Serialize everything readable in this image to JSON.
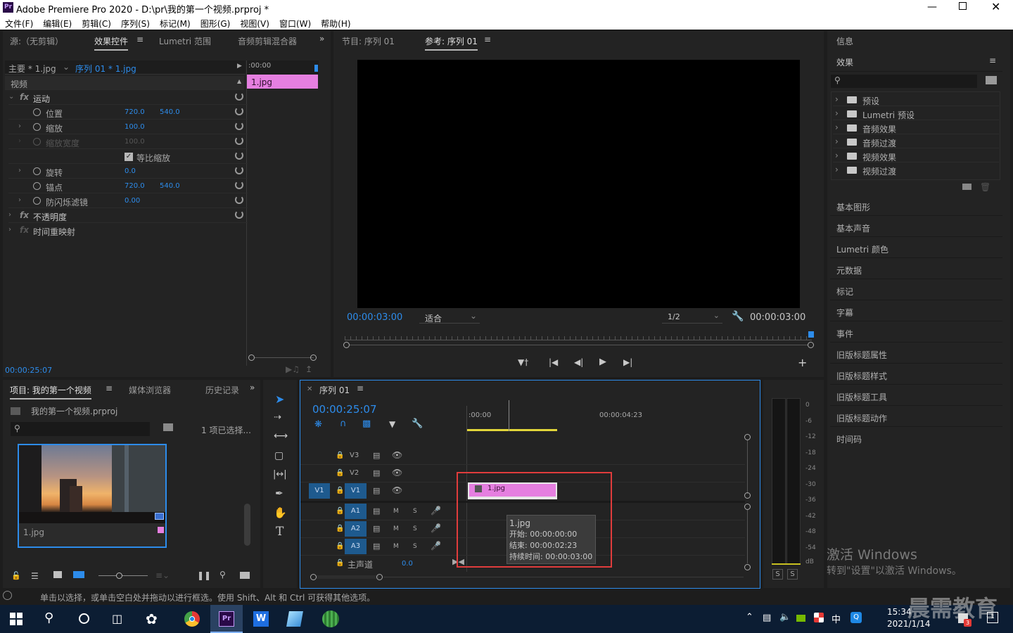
{
  "window": {
    "title": "Adobe Premiere Pro 2020 - D:\\pr\\我的第一个视频.prproj *",
    "app_icon": "Pr"
  },
  "menu": [
    "文件(F)",
    "编辑(E)",
    "剪辑(C)",
    "序列(S)",
    "标记(M)",
    "图形(G)",
    "视图(V)",
    "窗口(W)",
    "帮助(H)"
  ],
  "effect_controls": {
    "tabs": [
      "源:（无剪辑）",
      "效果控件",
      "Lumetri 范围",
      "音频剪辑混合器"
    ],
    "master": "主要 * 1.jpg",
    "sequence": "序列 01 * 1.jpg",
    "ruler_time": ":00:00",
    "clip_name": "1.jpg",
    "video_header": "视频",
    "motion": "运动",
    "properties": [
      {
        "name": "位置",
        "v1": "720.0",
        "v2": "540.0"
      },
      {
        "name": "缩放",
        "v1": "100.0",
        "v2": ""
      },
      {
        "name": "缩放宽度",
        "v1": "100.0",
        "v2": ""
      },
      {
        "name": "等比缩放",
        "v1": "",
        "v2": ""
      },
      {
        "name": "旋转",
        "v1": "0.0",
        "v2": ""
      },
      {
        "name": "锚点",
        "v1": "720.0",
        "v2": "540.0"
      },
      {
        "name": "防闪烁滤镜",
        "v1": "0.00",
        "v2": ""
      }
    ],
    "opacity": "不透明度",
    "time_remap": "时间重映射",
    "timecode": "00:00:25:07"
  },
  "program": {
    "tabs": [
      "节目: 序列 01",
      "参考: 序列 01"
    ],
    "timecode_left": "00:00:03:00",
    "fit": "适合",
    "resolution": "1/2",
    "timecode_right": "00:00:03:00"
  },
  "project": {
    "tabs": [
      "项目: 我的第一个视频",
      "媒体浏览器",
      "历史记录"
    ],
    "file": "我的第一个视频.prproj",
    "selected": "1 项已选择...",
    "thumb_label": "1.jpg"
  },
  "timeline": {
    "tab": "序列 01",
    "timecode": "00:00:25:07",
    "ruler": [
      ":00:00",
      "00:00:04:23"
    ],
    "video_tracks": [
      "V3",
      "V2",
      "V1"
    ],
    "audio_tracks": [
      "A1",
      "A2",
      "A3"
    ],
    "source_patch": "V1",
    "master": "主声道",
    "master_val": "0.0",
    "clip": "1.jpg",
    "tooltip": {
      "name": "1.jpg",
      "start": "开始: 00:00:00:00",
      "end": "结束: 00:00:02:23",
      "duration": "持续时间: 00:00:03:00"
    }
  },
  "meter": {
    "labels": [
      "0",
      "-6",
      "-12",
      "-18",
      "-24",
      "-30",
      "-36",
      "-42",
      "-48",
      "-54",
      "dB"
    ],
    "solo": [
      "S",
      "S"
    ]
  },
  "right_panel": {
    "info": "信息",
    "effects": "效果",
    "tree": [
      "预设",
      "Lumetri 预设",
      "音频效果",
      "音频过渡",
      "视频效果",
      "视频过渡"
    ],
    "items": [
      "基本图形",
      "基本声音",
      "Lumetri 颜色",
      "元数据",
      "标记",
      "字幕",
      "事件",
      "旧版标题属性",
      "旧版标题样式",
      "旧版标题工具",
      "旧版标题动作",
      "时间码"
    ]
  },
  "status": "单击以选择，或单击空白处并拖动以进行框选。使用 Shift、Alt 和 Ctrl 可获得其他选项。",
  "watermark": {
    "line1": "激活 Windows",
    "line2": "转到\"设置\"以激活 Windows。"
  },
  "taskbar": {
    "time": "15:34",
    "date": "2021/1/14",
    "ime": "中",
    "brand": "晨需教育",
    "badge": "3",
    "notify": "1"
  },
  "colors": {
    "accent": "#2d8ceb",
    "clip": "#e57fe0",
    "highlight": "#e03c3c",
    "panel": "#232323"
  }
}
